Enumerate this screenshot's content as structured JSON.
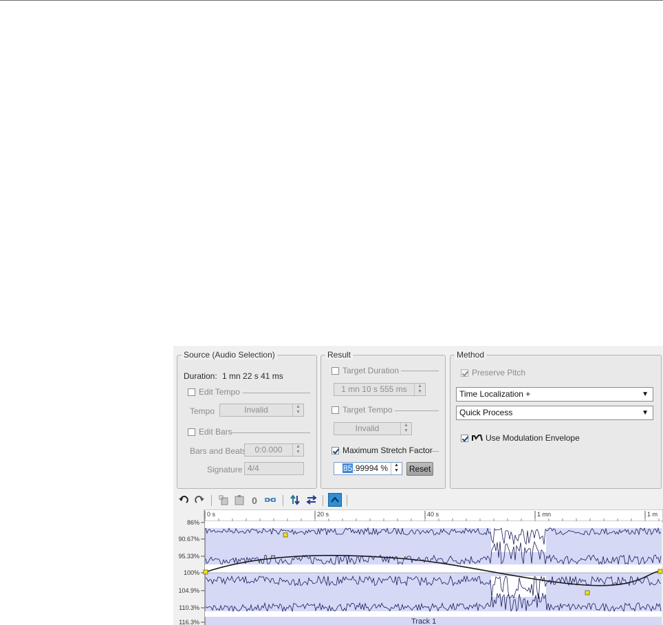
{
  "source": {
    "title": "Source (Audio Selection)",
    "duration_label": "Duration:",
    "duration_value": "1 mn 22 s 41 ms",
    "edit_tempo_label": "Edit Tempo",
    "tempo_label": "Tempo",
    "tempo_value": "Invalid",
    "edit_bars_label": "Edit Bars",
    "bars_beats_label": "Bars and Beats",
    "bars_beats_value": "0:0.000",
    "signature_label": "Signature",
    "signature_value": "4/4"
  },
  "result": {
    "title": "Result",
    "target_duration_label": "Target Duration",
    "target_duration_value": "1 mn 10 s 555 ms",
    "target_tempo_label": "Target Tempo",
    "target_tempo_value": "Invalid",
    "max_stretch_label": "Maximum Stretch Factor",
    "max_stretch_selected": "85",
    "max_stretch_rest": ".99994 %",
    "reset_label": "Reset"
  },
  "method": {
    "title": "Method",
    "preserve_pitch_label": "Preserve Pitch",
    "algorithm_value": "Time Localization +",
    "quality_value": "Quick Process",
    "use_modulation_label": "Use Modulation Envelope"
  },
  "toolbar": {
    "icons": [
      "undo-icon",
      "redo-icon",
      "copy-icon",
      "paste-icon",
      "reset-zero-icon",
      "link-icon",
      "flip-vertical-icon",
      "swap-icon",
      "envelope-mode-icon"
    ]
  },
  "graph": {
    "time_ticks": [
      "0 s",
      "20 s",
      "40 s",
      "1 mn",
      "1 m"
    ],
    "y_ticks": [
      "86%",
      "90.67%",
      "95.33%",
      "100%",
      "104.9%",
      "110.3%",
      "116.3%"
    ],
    "track_label": "Track 1",
    "colors": {
      "area": "#d5d9f6",
      "waveform": "#1a1a5a",
      "envelope": "#1a1a1a",
      "node": "#e8e420"
    }
  }
}
